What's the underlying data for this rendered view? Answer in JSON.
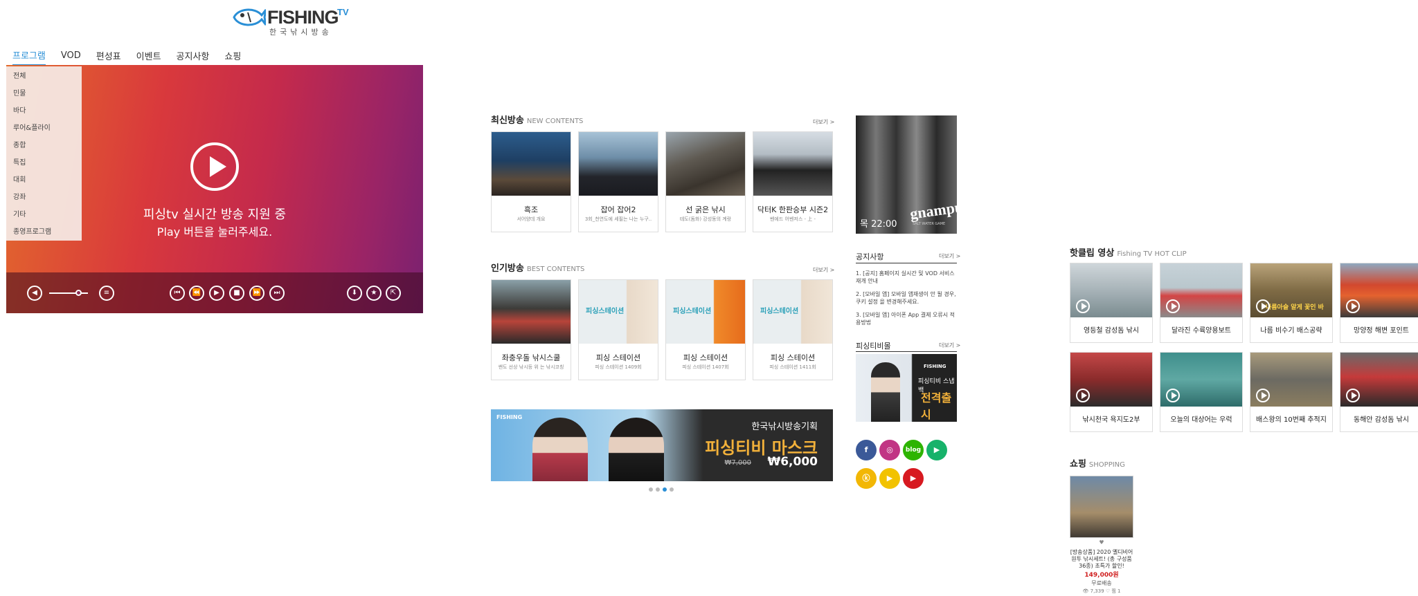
{
  "logo": {
    "main": "FISHING",
    "tv": "TV",
    "sub": "한국낚시방송"
  },
  "nav": [
    "프로그램",
    "VOD",
    "편성표",
    "이벤트",
    "공지사항",
    "쇼핑"
  ],
  "dropdown": [
    "전체",
    "민물",
    "바다",
    "루어&플라이",
    "종합",
    "특집",
    "대회",
    "강좌",
    "기타",
    "종영프로그램"
  ],
  "player": {
    "msg1": "피싱tv 실시간 방송 지원 중",
    "msg2": "Play 버튼을 눌러주세요.",
    "volume": 0.75,
    "ctrl_glyphs": {
      "volume": "◀",
      "playlist": "≡",
      "prev": "⏮",
      "rewind": "⏪",
      "play": "▶",
      "stop": "■",
      "forward": "⏩",
      "next": "⏭",
      "download": "⬇",
      "favorite": "★",
      "share": "⇱"
    }
  },
  "new_contents": {
    "title": "최신방송",
    "title_en": "NEW CONTENTS",
    "more": "더보기 >",
    "items": [
      {
        "title": "흑조",
        "sub": "서어양데 개요"
      },
      {
        "title": "잡어 잡어2",
        "sub": "3회_천연도에 세필는 나는 누구.."
      },
      {
        "title": "선 굵은 낚시",
        "sub": "테도(돔화) 강성동의 계랑"
      },
      {
        "title": "닥터K 한판승부 시즌2",
        "sub": "벤에드 어벤저스 - 上 -"
      }
    ]
  },
  "best_contents": {
    "title": "인기방송",
    "title_en": "BEST CONTENTS",
    "more": "더보기 >",
    "items": [
      {
        "title": "좌충우돌 낚시스쿨",
        "sub": "쌘도 선상 낚시등 위 는 낚시코칭"
      },
      {
        "title": "피싱 스테이션",
        "sub": "피싱 스테이션 1409회"
      },
      {
        "title": "피싱 스테이션",
        "sub": "피싱 스테이션 1407회"
      },
      {
        "title": "피싱 스테이션",
        "sub": "피싱 스테이션 1411회"
      }
    ],
    "thumb_label": "피싱스테이션"
  },
  "banner": {
    "logo": "FISHING",
    "line1": "한국낚시방송기획",
    "line2": "피싱티비 마스크",
    "old_price": "₩7,000",
    "price": "₩6,000",
    "active_dot": 2,
    "dot_count": 4
  },
  "promo": {
    "time": "목 22:00",
    "brand": "gnampus",
    "tagline": "SALT WATER GAME"
  },
  "notice": {
    "title": "공지사항",
    "more": "더보기 >",
    "items": [
      "1. [공지] 홈페이지 실시간 및 VOD 서비스 재개 안내",
      "2. [모바일 앱] 모바일 앱재생이 안 될 경우, 쿠키 설정 을 변경해주세요.",
      "3. [모바일 앱] 아이폰 App 결제 오류시 적용방법"
    ]
  },
  "fishingtv_mall": {
    "title": "피싱티비몰",
    "more": "더보기 >",
    "ad_logo": "FISHING",
    "ad_line1": "피싱티비 스냅백",
    "ad_line2": "전격출시"
  },
  "social": [
    {
      "name": "facebook",
      "label": "f",
      "color": "#3b5998"
    },
    {
      "name": "instagram",
      "label": "◎",
      "color": "#c13584"
    },
    {
      "name": "blog",
      "label": "blog",
      "color": "#2db400"
    },
    {
      "name": "play",
      "label": "▶",
      "color": "#17b26a"
    },
    {
      "name": "kakao",
      "label": "ⓚ",
      "color": "#f2b705"
    },
    {
      "name": "kakao-tv",
      "label": "▶",
      "color": "#f2c200"
    },
    {
      "name": "youtube",
      "label": "▶",
      "color": "#d71920"
    }
  ],
  "hot_clips": {
    "title": "핫클립 영상",
    "title_en": "Fishing TV HOT CLIP",
    "items": [
      "영등철 감성돔 낚시",
      "달라진 수륙양용보트",
      "나름 비수기 배스공략",
      "망양정 해변 포인트",
      "낚시천국 욕지도2부",
      "오늘의 대상어는 우럭",
      "배스왕의 10번째 추적지",
      "동해안 감성돔 낚시"
    ],
    "overlay": "나름아슬 알게 꽃인 바"
  },
  "shopping": {
    "title": "쇼핑",
    "title_en": "SHOPPING",
    "item": {
      "heart": "♥",
      "name": "[방송상품] 2020 옐디비어 원투 낚시세트! (총 구성품 36종) 초특가 할인!",
      "price": "149,000원",
      "shipping": "무료배송",
      "views": "👁 7,339 ♡ 찜 1"
    }
  }
}
